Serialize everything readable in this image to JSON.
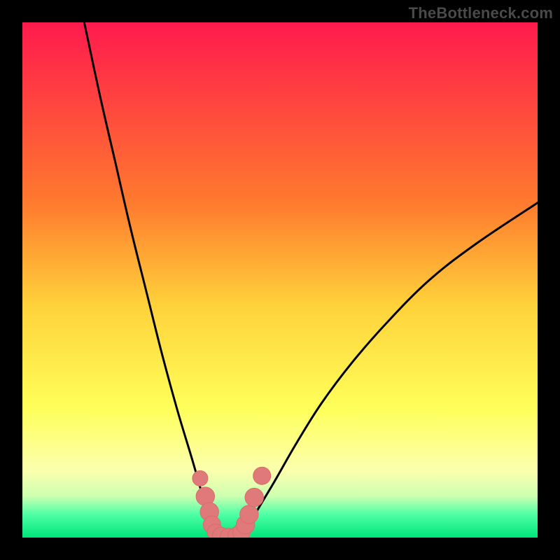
{
  "watermark": "TheBottleneck.com",
  "colors": {
    "frame": "#000000",
    "curve": "#000000",
    "marker_fill": "#e07a7a",
    "marker_stroke": "#d96b6b",
    "gradient_stops": [
      {
        "offset": 0.0,
        "color": "#ff1a4d"
      },
      {
        "offset": 0.35,
        "color": "#ff7a2e"
      },
      {
        "offset": 0.55,
        "color": "#ffd23a"
      },
      {
        "offset": 0.75,
        "color": "#ffff5a"
      },
      {
        "offset": 0.87,
        "color": "#fbffae"
      },
      {
        "offset": 0.92,
        "color": "#ccffb0"
      },
      {
        "offset": 0.955,
        "color": "#4effa6"
      },
      {
        "offset": 1.0,
        "color": "#00e57a"
      }
    ]
  },
  "chart_data": {
    "type": "line",
    "title": "",
    "xlabel": "",
    "ylabel": "",
    "xlim": [
      0,
      100
    ],
    "ylim": [
      0,
      100
    ],
    "grid": false,
    "legend": false,
    "series": [
      {
        "name": "left-branch",
        "x": [
          12,
          15,
          18,
          21,
          24,
          27,
          30,
          33,
          35,
          36.5,
          37.5
        ],
        "y": [
          100,
          86,
          73,
          60,
          48,
          36,
          25,
          15,
          8,
          3,
          0
        ]
      },
      {
        "name": "right-branch",
        "x": [
          42.5,
          44,
          46,
          49,
          53,
          58,
          64,
          71,
          79,
          88,
          100
        ],
        "y": [
          0,
          2.5,
          6,
          11,
          18,
          26,
          34,
          42,
          50,
          57,
          65
        ]
      }
    ],
    "markers": [
      {
        "x": 34.5,
        "y": 11.5,
        "r": 1.5
      },
      {
        "x": 35.5,
        "y": 8.0,
        "r": 1.8
      },
      {
        "x": 36.3,
        "y": 5.0,
        "r": 1.8
      },
      {
        "x": 36.8,
        "y": 2.5,
        "r": 1.7
      },
      {
        "x": 37.5,
        "y": 1.0,
        "r": 1.6
      },
      {
        "x": 38.5,
        "y": 0.4,
        "r": 1.6
      },
      {
        "x": 40.0,
        "y": 0.2,
        "r": 1.6
      },
      {
        "x": 41.5,
        "y": 0.4,
        "r": 1.6
      },
      {
        "x": 42.5,
        "y": 1.0,
        "r": 1.7
      },
      {
        "x": 43.3,
        "y": 2.5,
        "r": 1.8
      },
      {
        "x": 44.0,
        "y": 4.5,
        "r": 1.8
      },
      {
        "x": 45.0,
        "y": 7.8,
        "r": 1.8
      },
      {
        "x": 46.5,
        "y": 12.0,
        "r": 1.7
      }
    ]
  }
}
